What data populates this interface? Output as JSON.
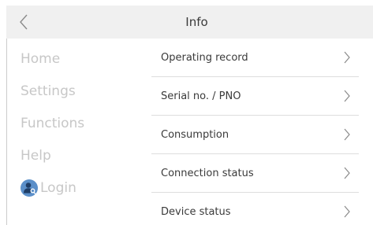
{
  "header": {
    "title": "Info",
    "back_icon": "chevron-left-icon"
  },
  "sidebar": {
    "items": [
      {
        "label": "Home"
      },
      {
        "label": "Settings"
      },
      {
        "label": "Functions"
      },
      {
        "label": "Help"
      }
    ],
    "login": {
      "label": "Login",
      "icon": "user-key-icon",
      "icon_color": "#5b8fc9"
    }
  },
  "menu": {
    "items": [
      {
        "label": "Operating record",
        "icon": "chevron-right-icon"
      },
      {
        "label": "Serial no. / PNO",
        "icon": "chevron-right-icon"
      },
      {
        "label": "Consumption",
        "icon": "chevron-right-icon"
      },
      {
        "label": "Connection status",
        "icon": "chevron-right-icon"
      },
      {
        "label": "Device status",
        "icon": "chevron-right-icon"
      }
    ]
  },
  "colors": {
    "header_bg": "#f0f0f0",
    "sidebar_text": "#c7c7c7",
    "menu_text": "#3a3a3a",
    "divider": "#dedede",
    "chevron": "#8a8a8a"
  }
}
